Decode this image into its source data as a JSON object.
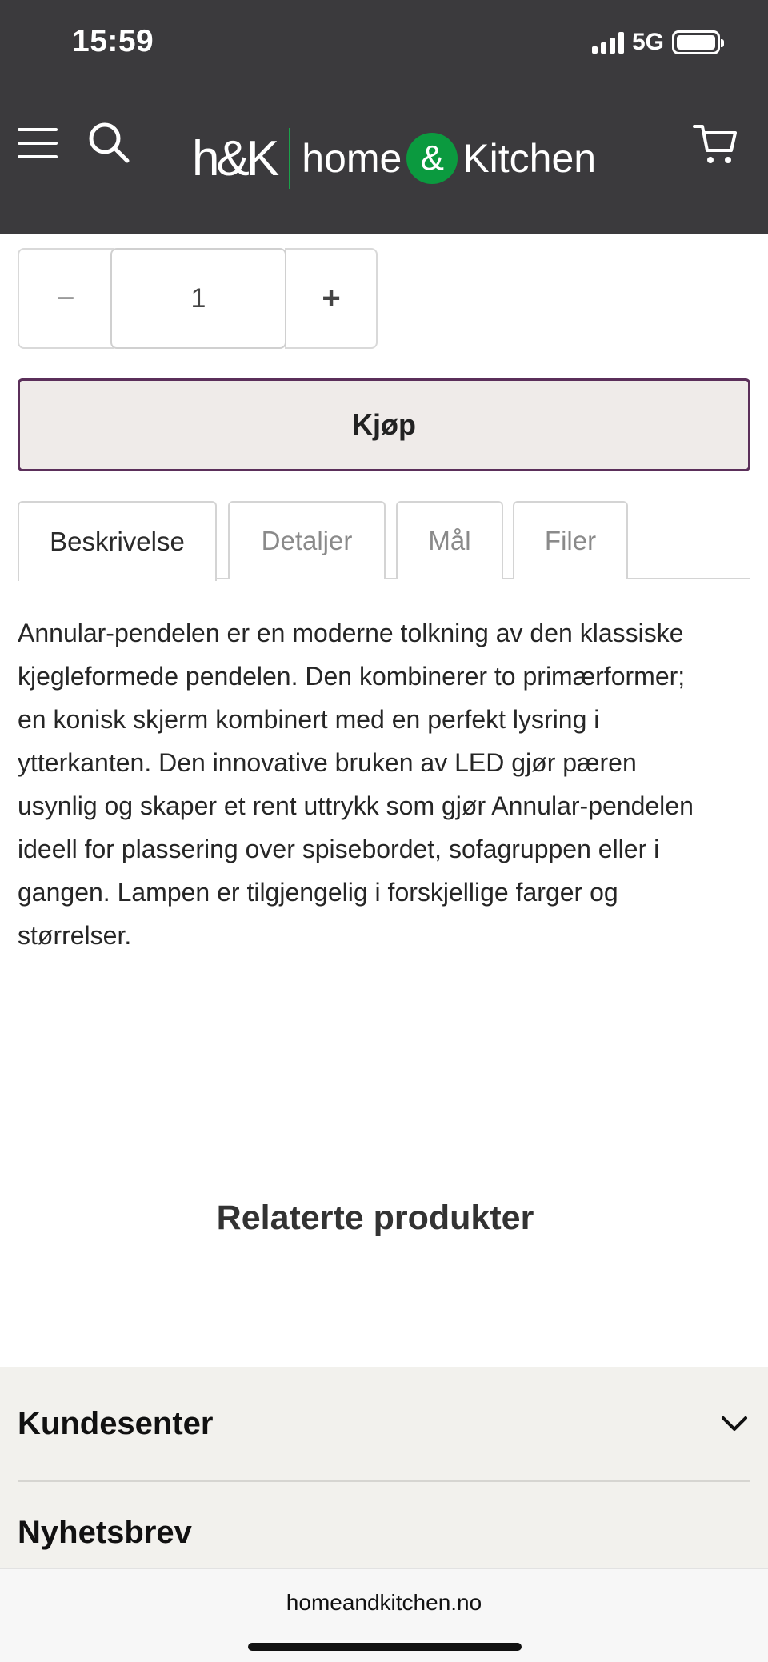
{
  "status_bar": {
    "time": "15:59",
    "network": "5G"
  },
  "header": {
    "logo_mark": "h&K",
    "logo_word_home": "home",
    "logo_amp": "&",
    "logo_word_kitchen": "Kitchen"
  },
  "quantity": {
    "minus": "−",
    "value": "1",
    "plus": "+"
  },
  "buy_button": {
    "label": "Kjøp"
  },
  "tabs": [
    {
      "label": "Beskrivelse",
      "active": true
    },
    {
      "label": "Detaljer",
      "active": false
    },
    {
      "label": "Mål",
      "active": false
    },
    {
      "label": "Filer",
      "active": false
    }
  ],
  "description": {
    "lines": [
      "Annular-pendelen er en moderne tolkning av den klassiske",
      "kjegleformede pendelen. Den kombinerer to primærformer;",
      "en konisk skjerm kombinert med en perfekt lysring i",
      "ytterkanten. Den innovative bruken av LED gjør pæren",
      "usynlig og skaper et rent uttrykk som gjør Annular-pendelen",
      "ideell for plassering over spisebordet, sofagruppen eller i",
      "gangen. Lampen er tilgjengelig i forskjellige farger og",
      "størrelser."
    ]
  },
  "related": {
    "title": "Relaterte produkter"
  },
  "footer": {
    "sections": [
      {
        "title": "Kundesenter"
      },
      {
        "title": "Nyhetsbrev"
      }
    ]
  },
  "browser": {
    "url": "homeandkitchen.no"
  },
  "colors": {
    "header_bg": "#3b3a3d",
    "logo_green": "#0b9a3f",
    "buy_border": "#5b2f5a",
    "buy_bg": "#efebe9",
    "footer_bg": "#f2f1ed"
  }
}
